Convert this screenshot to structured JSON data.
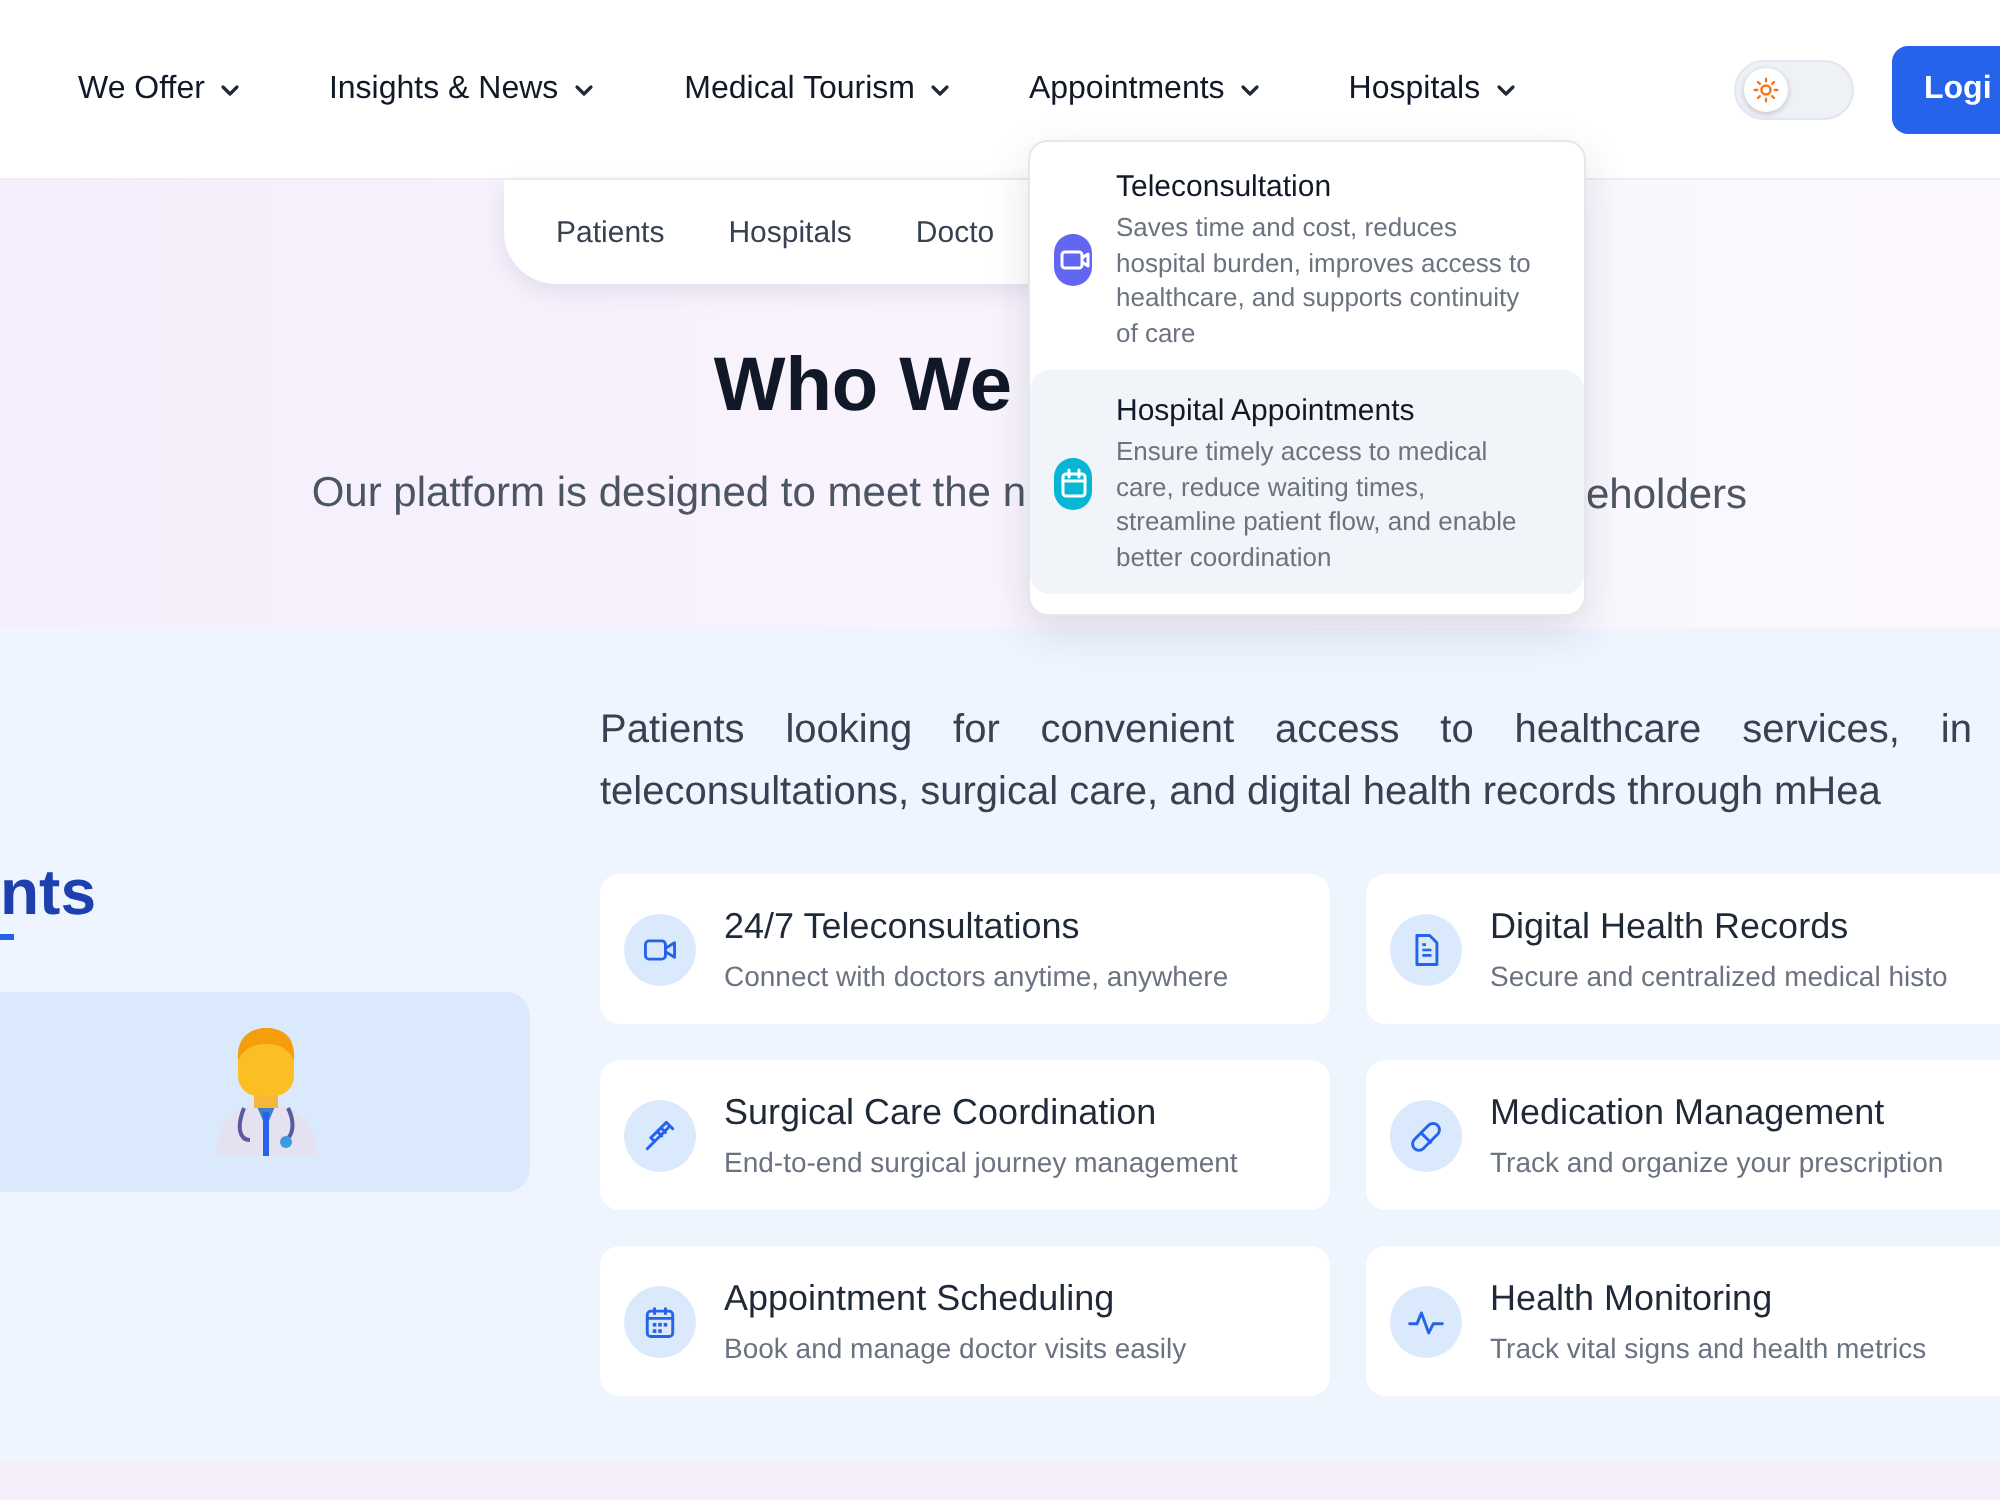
{
  "nav": {
    "items": [
      {
        "label": "We Offer"
      },
      {
        "label": "Insights & News"
      },
      {
        "label": "Medical Tourism"
      },
      {
        "label": "Appointments"
      },
      {
        "label": "Hospitals"
      }
    ],
    "theme_toggle": {
      "on": false
    },
    "login_button": "Logi"
  },
  "audience_tabs": [
    "Patients",
    "Hospitals",
    "Docto"
  ],
  "hero": {
    "heading": "Who We",
    "subtitle_left": "Our platform is designed to meet the n",
    "subtitle_right": "eholders"
  },
  "dropdown": {
    "items": [
      {
        "title": "Teleconsultation",
        "description": "Saves time and cost, reduces hospital burden, improves access to healthcare, and supports continuity of care",
        "selected": false,
        "color": "#6366f1"
      },
      {
        "title": "Hospital Appointments",
        "description": "Ensure timely access to medical care, reduce waiting times, streamline patient flow, and enable better coordination",
        "selected": true,
        "color": "#06b6d4"
      }
    ]
  },
  "audience": {
    "title": "nts",
    "description_lines": [
      "Patients looking for convenient access to healthcare services, in",
      "teleconsultations, surgical care, and digital health records through mHea"
    ],
    "features": [
      {
        "title": "24/7 Teleconsultations",
        "description": "Connect with doctors anytime, anywhere"
      },
      {
        "title": "Digital Health Records",
        "description": "Secure and centralized medical histo"
      },
      {
        "title": "Surgical Care Coordination",
        "description": "End-to-end surgical journey management"
      },
      {
        "title": "Medication Management",
        "description": "Track and organize your prescription"
      },
      {
        "title": "Appointment Scheduling",
        "description": "Book and manage doctor visits easily"
      },
      {
        "title": "Health Monitoring",
        "description": "Track vital signs and health metrics"
      }
    ]
  }
}
